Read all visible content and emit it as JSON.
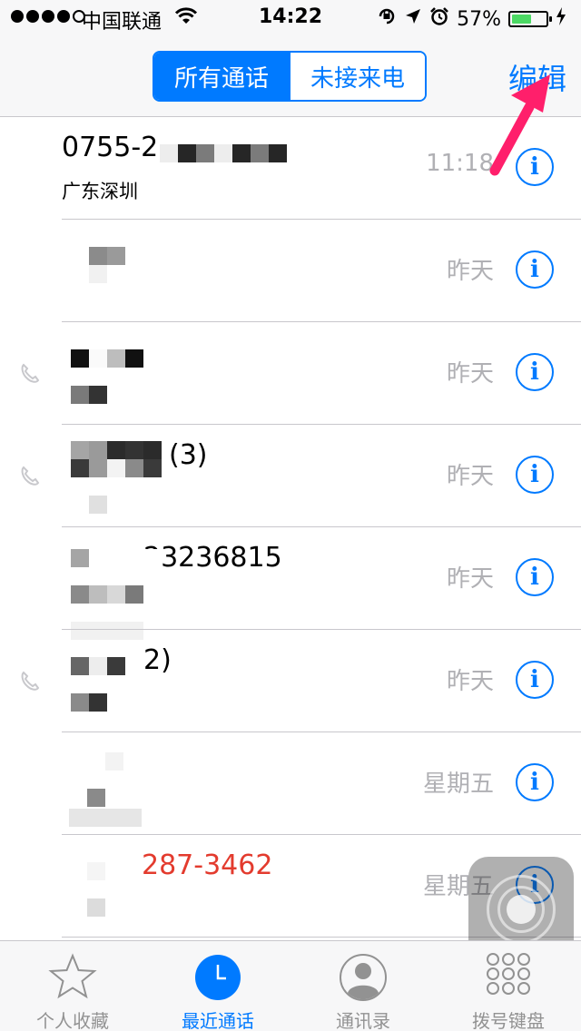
{
  "status_bar": {
    "carrier": "中国联通",
    "time": "14:22",
    "battery_percent": "57%",
    "battery_level": 0.57,
    "signal_bars_filled": 4,
    "signal_bars_total": 5
  },
  "nav": {
    "segments": [
      {
        "label": "所有通话",
        "active": true
      },
      {
        "label": "未接来电",
        "active": false
      }
    ],
    "edit_label": "编辑"
  },
  "calls": [
    {
      "name": "0755-2",
      "sub": "广东深圳",
      "time": "11:18",
      "missed": false,
      "outgoing": false
    },
    {
      "name": "",
      "sub": "",
      "time": "昨天",
      "missed": false,
      "outgoing": false
    },
    {
      "name": "",
      "sub": "",
      "time": "昨天",
      "missed": false,
      "outgoing": true
    },
    {
      "name": "(3)",
      "sub": "",
      "time": "昨天",
      "missed": false,
      "outgoing": true
    },
    {
      "name": "23236815",
      "sub": "",
      "time": "昨天",
      "missed": false,
      "outgoing": false
    },
    {
      "name": "2)",
      "sub": "",
      "time": "昨天",
      "missed": false,
      "outgoing": true
    },
    {
      "name": "",
      "sub": "",
      "time": "星期五",
      "missed": false,
      "outgoing": false
    },
    {
      "name": "287-3462",
      "sub": "",
      "time": "星期五",
      "missed": true,
      "outgoing": false
    }
  ],
  "info_glyph": "i",
  "tabbar": {
    "tabs": [
      {
        "label": "个人收藏",
        "icon": "star-icon",
        "active": false
      },
      {
        "label": "最近通话",
        "icon": "clock-icon",
        "active": true
      },
      {
        "label": "通讯录",
        "icon": "contact-icon",
        "active": false
      },
      {
        "label": "拨号键盘",
        "icon": "keypad-icon",
        "active": false
      }
    ]
  },
  "colors": {
    "accent": "#007aff",
    "missed": "#e33b2e",
    "annotation_arrow": "#ff1f6b",
    "battery_fill": "#4cd964"
  }
}
